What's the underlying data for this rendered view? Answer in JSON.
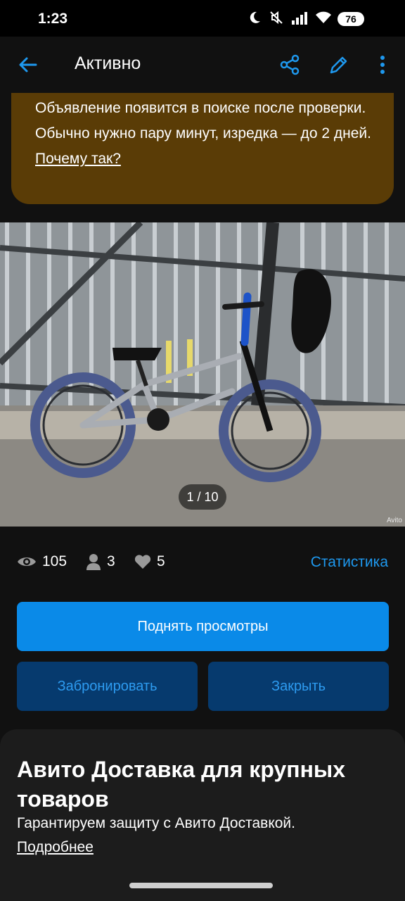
{
  "status_bar": {
    "time": "1:23",
    "battery": "76"
  },
  "app_bar": {
    "title": "Активно",
    "back_icon": "arrow-left-icon",
    "share_icon": "share-icon",
    "edit_icon": "pencil-icon",
    "more_icon": "more-vertical-icon"
  },
  "notice": {
    "text": "Объявление появится в поиске после проверки. Обычно нужно пару минут, изредка — до 2 дней.",
    "link": "Почему так?"
  },
  "photo": {
    "counter": "1 / 10",
    "watermark": "Avito"
  },
  "stats": {
    "views": "105",
    "contacts": "3",
    "favorites": "5",
    "link": "Статистика"
  },
  "actions": {
    "promote": "Поднять просмотры",
    "book": "Забронировать",
    "close": "Закрыть"
  },
  "delivery": {
    "heading": "Авито Доставка для крупных товаров",
    "subtitle": "Гарантируем защиту с Авито Доставкой.",
    "more": "Подробнее"
  },
  "colors": {
    "accent": "#0a8ae8",
    "notice_bg": "#5a3c06",
    "secondary_button_bg": "#063a6e"
  }
}
